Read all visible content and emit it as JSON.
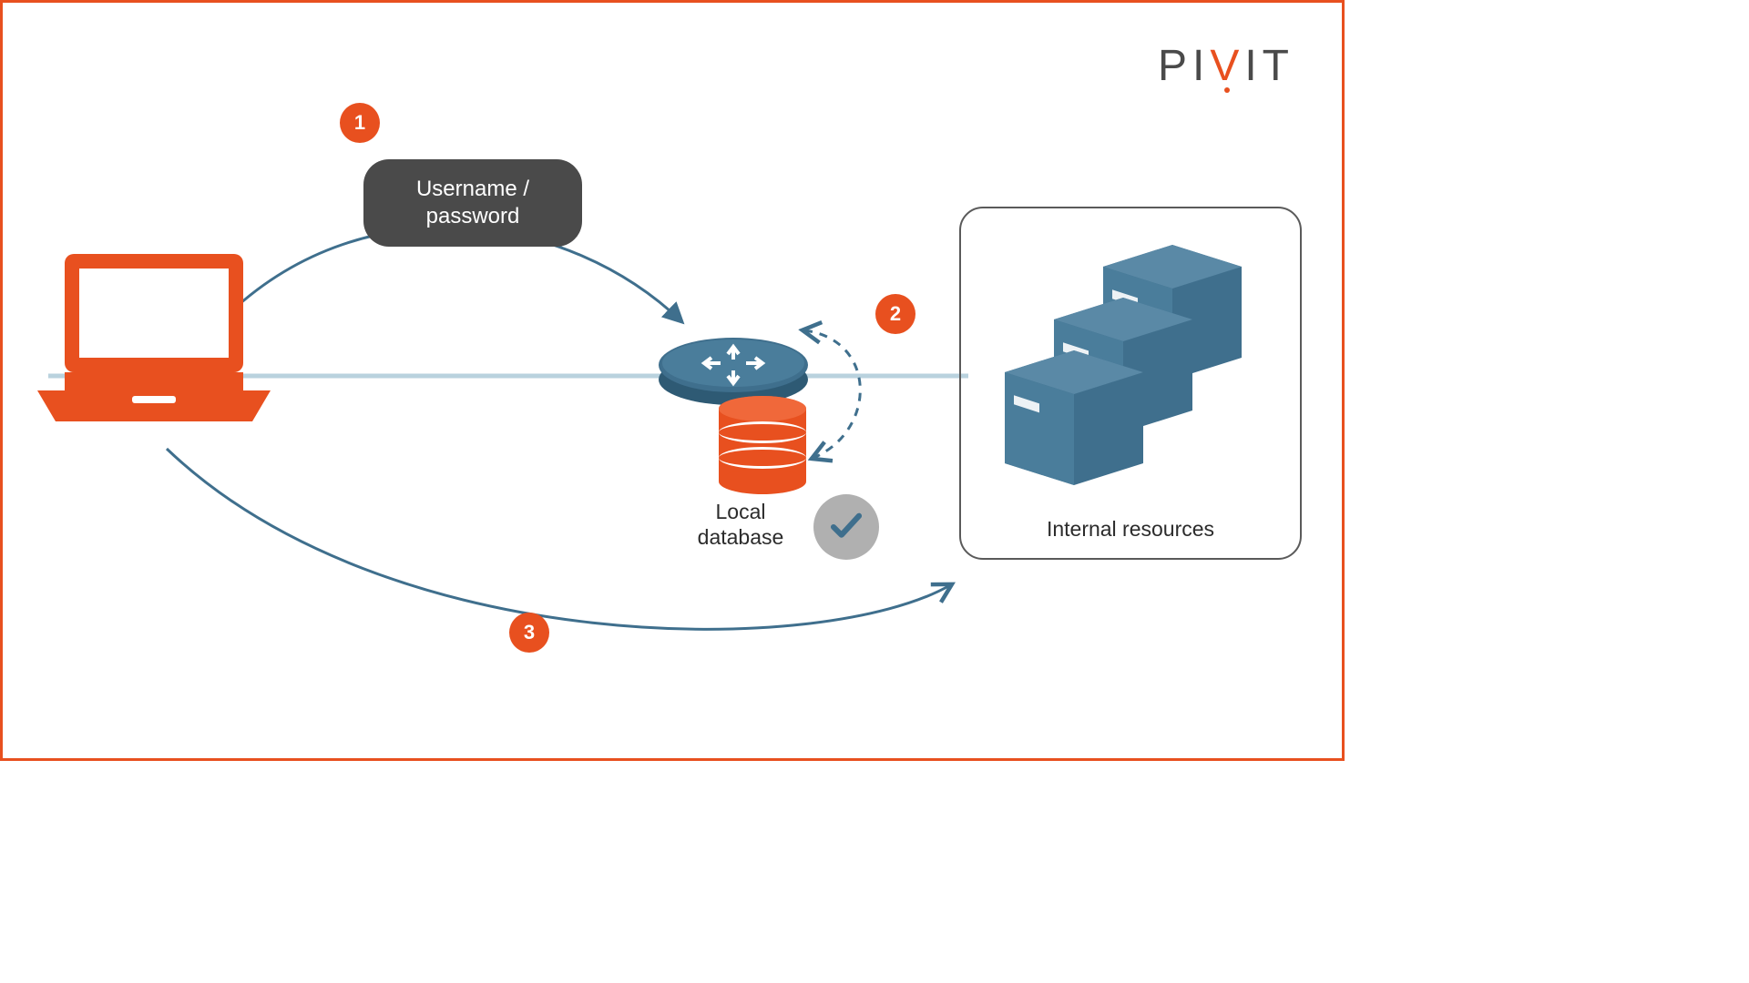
{
  "brand": {
    "p1": "PI",
    "v": "V",
    "p2": "IT"
  },
  "steps": {
    "s1": {
      "num": "1",
      "label_line1": "Username /",
      "label_line2": "password"
    },
    "s2": {
      "num": "2"
    },
    "s3": {
      "num": "3"
    }
  },
  "labels": {
    "local_db_line1": "Local",
    "local_db_line2": "database",
    "internal_resources": "Internal resources"
  },
  "colors": {
    "accent": "#e8501f",
    "steel": "#3f6f8d",
    "grey": "#b0b0b0"
  }
}
